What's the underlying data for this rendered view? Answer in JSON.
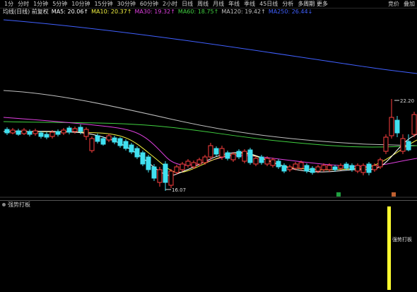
{
  "toolbar": {
    "periods": [
      "1分",
      "分时",
      "1分钟",
      "5分钟",
      "10分钟",
      "15分钟",
      "30分钟",
      "60分钟",
      "2小时",
      "日线",
      "周线",
      "月线",
      "年线",
      "季线",
      "45日线",
      "分析"
    ],
    "more_label": "多周期 更多",
    "right_left": "竞价",
    "right_right": "叠加"
  },
  "ma_legend": {
    "prefix": "均线(日线) 前复权",
    "items": [
      {
        "label": "MA5: 20.06↑",
        "color": "#ffffff"
      },
      {
        "label": "MA10: 20.37↑",
        "color": "#f0f040"
      },
      {
        "label": "MA30: 19.32↑",
        "color": "#e040e0"
      },
      {
        "label": "MA60: 18.75↑",
        "color": "#40d040"
      },
      {
        "label": "MA120: 19.42↑",
        "color": "#c0c0c0"
      },
      {
        "label": "MA250: 26.44↓",
        "color": "#4060ff"
      }
    ]
  },
  "annotations": {
    "high_label": "22.20",
    "low_label": "16.07"
  },
  "sub_indicator": {
    "title": "强势打板",
    "signal_label": "强势打板"
  },
  "colors": {
    "up": "#ff4040",
    "down": "#40e0f0",
    "signal": "#ffff30"
  }
}
